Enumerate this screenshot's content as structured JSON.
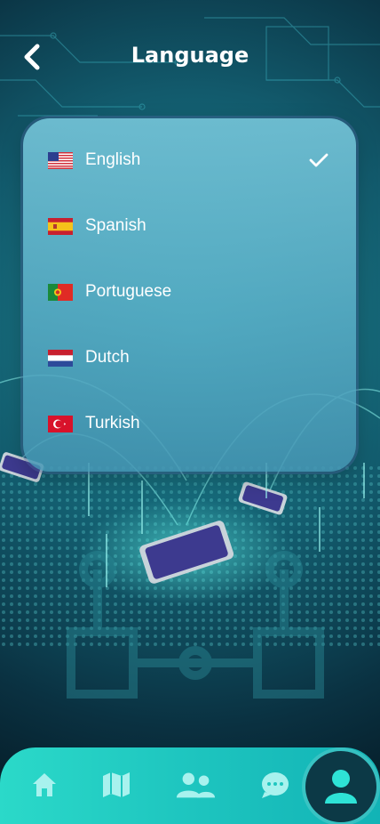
{
  "header": {
    "title": "Language",
    "back_icon": "chevron-left-icon"
  },
  "languages": [
    {
      "label": "English",
      "flag": "us-flag-icon",
      "selected": true
    },
    {
      "label": "Spanish",
      "flag": "es-flag-icon",
      "selected": false
    },
    {
      "label": "Portuguese",
      "flag": "pt-flag-icon",
      "selected": false
    },
    {
      "label": "Dutch",
      "flag": "nl-flag-icon",
      "selected": false
    },
    {
      "label": "Turkish",
      "flag": "tr-flag-icon",
      "selected": false
    }
  ],
  "bottom_nav": {
    "items": [
      {
        "icon": "home-icon"
      },
      {
        "icon": "map-icon"
      },
      {
        "icon": "users-icon"
      },
      {
        "icon": "chat-icon"
      },
      {
        "icon": "profile-icon",
        "active": true
      }
    ]
  },
  "colors": {
    "accent": "#1fc7c0",
    "nav_active_bg": "#0c3946",
    "icon_color": "#a8f2ee"
  }
}
